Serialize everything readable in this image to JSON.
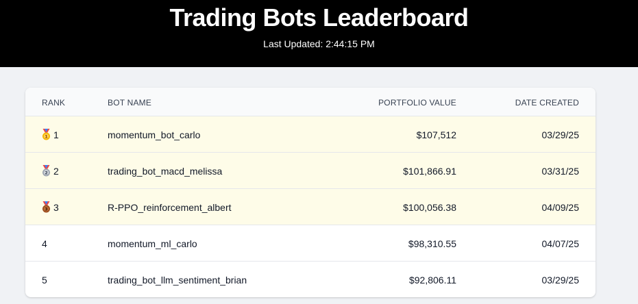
{
  "header": {
    "title": "Trading Bots Leaderboard",
    "last_updated_label": "Last Updated: 2:44:15 PM"
  },
  "table": {
    "columns": {
      "rank": "RANK",
      "bot_name": "BOT NAME",
      "portfolio_value": "PORTFOLIO VALUE",
      "date_created": "DATE CREATED"
    },
    "rows": [
      {
        "rank": "1",
        "medal": "gold-medal-icon",
        "name": "momentum_bot_carlo",
        "value": "$107,512",
        "date": "03/29/25"
      },
      {
        "rank": "2",
        "medal": "silver-medal-icon",
        "name": "trading_bot_macd_melissa",
        "value": "$101,866.91",
        "date": "03/31/25"
      },
      {
        "rank": "3",
        "medal": "bronze-medal-icon",
        "name": "R-PPO_reinforcement_albert",
        "value": "$100,056.38",
        "date": "04/09/25"
      },
      {
        "rank": "4",
        "name": "momentum_ml_carlo",
        "value": "$98,310.55",
        "date": "04/07/25"
      },
      {
        "rank": "5",
        "name": "trading_bot_llm_sentiment_brian",
        "value": "$92,806.11",
        "date": "03/29/25"
      }
    ]
  },
  "colors": {
    "header_bg": "#000000",
    "page_bg": "#f0f2f5",
    "top3_row_bg": "#fefce8",
    "gold": "#f5b400",
    "silver": "#a8a8a8",
    "bronze": "#b05d26"
  }
}
